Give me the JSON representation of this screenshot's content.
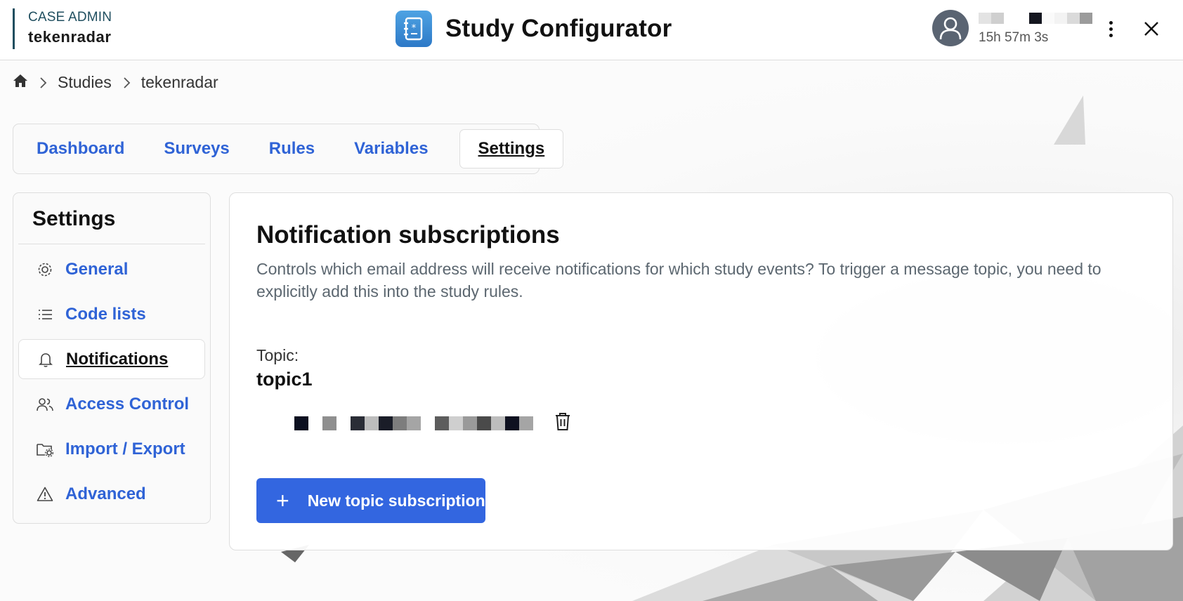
{
  "header": {
    "role": "CASE ADMIN",
    "instance": "tekenradar",
    "app_title": "Study Configurator",
    "session_time": "15h 57m 3s"
  },
  "breadcrumb": {
    "items": [
      "Studies",
      "tekenradar"
    ]
  },
  "tabs": [
    {
      "label": "Dashboard",
      "active": false
    },
    {
      "label": "Surveys",
      "active": false
    },
    {
      "label": "Rules",
      "active": false
    },
    {
      "label": "Variables",
      "active": false
    },
    {
      "label": "Settings",
      "active": true
    }
  ],
  "sidebar": {
    "title": "Settings",
    "items": [
      {
        "label": "General",
        "icon": "gear-icon",
        "active": false
      },
      {
        "label": "Code lists",
        "icon": "list-icon",
        "active": false
      },
      {
        "label": "Notifications",
        "icon": "bell-icon",
        "active": true
      },
      {
        "label": "Access Control",
        "icon": "users-icon",
        "active": false
      },
      {
        "label": "Import / Export",
        "icon": "folder-gear-icon",
        "active": false
      },
      {
        "label": "Advanced",
        "icon": "warning-icon",
        "active": false
      }
    ]
  },
  "main": {
    "title": "Notification subscriptions",
    "description": "Controls which email address will receive notifications for which study events? To trigger a message topic, you need to explicitly add this into the study rules.",
    "topic_label": "Topic:",
    "topic_name": "topic1",
    "new_button_label": "New topic subscription"
  },
  "colors": {
    "accent": "#3366e0",
    "link": "#2f63d6",
    "brand_border": "#1f4e5f"
  }
}
